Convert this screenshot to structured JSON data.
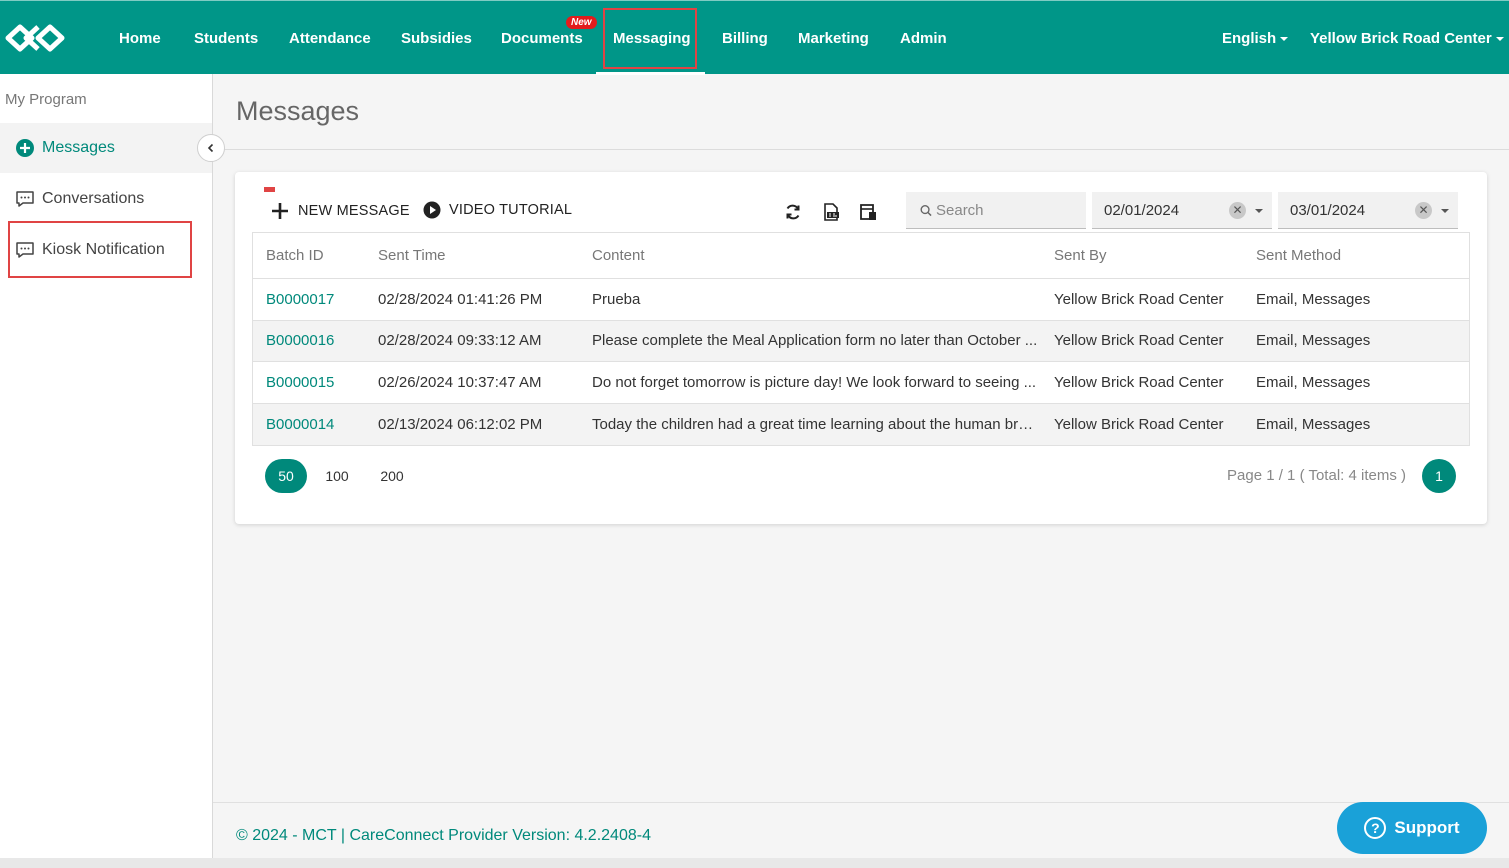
{
  "nav": {
    "items": [
      "Home",
      "Students",
      "Attendance",
      "Subsidies",
      "Documents",
      "Messaging",
      "Billing",
      "Marketing",
      "Admin"
    ],
    "active": "Messaging",
    "documents_badge": "New",
    "language": "English",
    "center": "Yellow Brick Road Center"
  },
  "sidebar": {
    "heading": "My Program",
    "items": [
      {
        "label": "Messages",
        "icon": "plus-circle-icon"
      },
      {
        "label": "Conversations",
        "icon": "chat-bubble-icon"
      },
      {
        "label": "Kiosk Notification",
        "icon": "chat-bubble-icon"
      }
    ]
  },
  "page": {
    "title": "Messages"
  },
  "toolbar": {
    "new_message": "NEW MESSAGE",
    "video_tutorial": "VIDEO TUTORIAL",
    "search_placeholder": "Search",
    "date_from": "02/01/2024",
    "date_to": "03/01/2024"
  },
  "table": {
    "columns": [
      "Batch ID",
      "Sent Time",
      "Content",
      "Sent By",
      "Sent Method"
    ],
    "rows": [
      {
        "batch_id": "B0000017",
        "sent_time": "02/28/2024 01:41:26 PM",
        "content": "Prueba",
        "sent_by": "Yellow Brick Road Center",
        "sent_method": "Email, Messages"
      },
      {
        "batch_id": "B0000016",
        "sent_time": "02/28/2024 09:33:12 AM",
        "content": "Please complete the Meal Application form no later than October ...",
        "sent_by": "Yellow Brick Road Center",
        "sent_method": "Email, Messages"
      },
      {
        "batch_id": "B0000015",
        "sent_time": "02/26/2024 10:37:47 AM",
        "content": "Do not forget tomorrow is picture day! We look forward to seeing ...",
        "sent_by": "Yellow Brick Road Center",
        "sent_method": "Email, Messages"
      },
      {
        "batch_id": "B0000014",
        "sent_time": "02/13/2024 06:12:02 PM",
        "content": "Today the children had a great time learning about the human brai...",
        "sent_by": "Yellow Brick Road Center",
        "sent_method": "Email, Messages"
      }
    ]
  },
  "pager": {
    "sizes": [
      "50",
      "100",
      "200"
    ],
    "active_size": "50",
    "info": "Page 1 / 1 ( Total: 4 items )",
    "current_page": "1"
  },
  "footer": {
    "text": "© 2024 - MCT | CareConnect Provider Version: 4.2.2408-4",
    "support": "Support"
  },
  "colors": {
    "brand": "#009688",
    "accent": "#00897b",
    "highlight": "#e04444",
    "support": "#1aa1d8"
  }
}
